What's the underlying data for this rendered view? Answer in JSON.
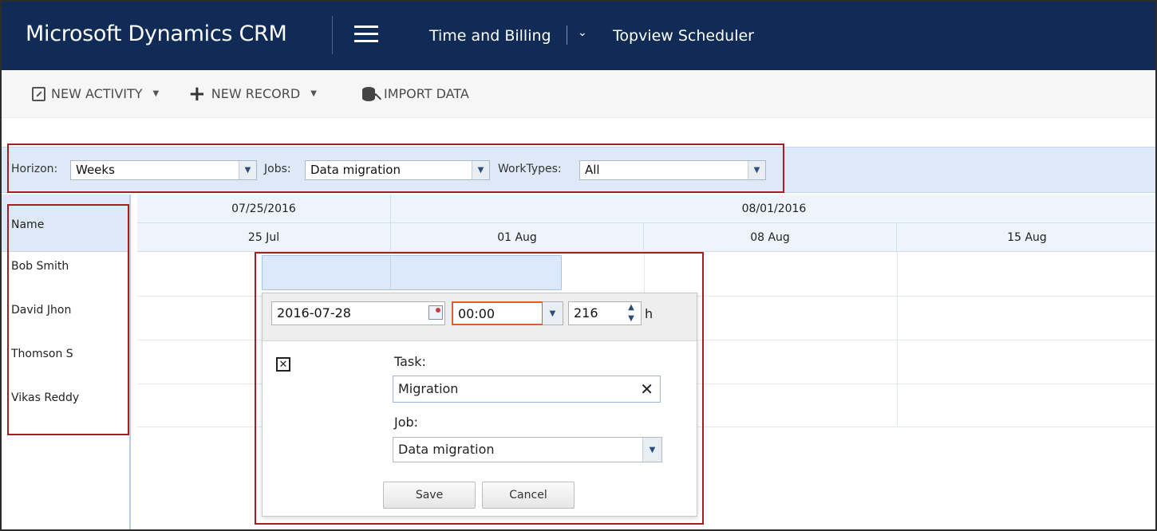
{
  "nav": {
    "app_title": "Microsoft Dynamics CRM",
    "area": "Time and Billing",
    "entity": "Topview Scheduler",
    "area_chevron": "⌄"
  },
  "command_bar": {
    "new_activity": "NEW ACTIVITY",
    "new_record": "NEW RECORD",
    "import_data": "IMPORT DATA",
    "caret": "▼"
  },
  "filters": {
    "horizon_label": "Horizon:",
    "horizon_value": "Weeks",
    "jobs_label": "Jobs:",
    "jobs_value": "Data migration",
    "worktypes_label": "WorkTypes:",
    "worktypes_value": "All",
    "dd_glyph": "▼"
  },
  "grid": {
    "name_header": "Name",
    "top_headers": [
      "07/25/2016",
      "08/01/2016"
    ],
    "week_headers": [
      "25 Jul",
      "01 Aug",
      "08 Aug",
      "15 Aug"
    ],
    "resources": [
      "Bob Smith",
      "David Jhon",
      "Thomson S",
      "Vikas Reddy"
    ]
  },
  "popup": {
    "date": "2016-07-28",
    "time": "00:00",
    "duration": "216",
    "duration_unit": "h",
    "spin_up": "▲",
    "spin_down": "▼",
    "close_glyph": "✕",
    "task_label": "Task:",
    "task_value": "Migration",
    "clear_glyph": "✕",
    "job_label": "Job:",
    "job_value": "Data migration",
    "save_label": "Save",
    "cancel_label": "Cancel"
  },
  "colors": {
    "nav_bg": "#0f2b56",
    "filter_bg": "#dde9f6",
    "highlight_border": "#a81d24",
    "event_bg": "#dbe9fb",
    "time_border": "#d9622b"
  }
}
